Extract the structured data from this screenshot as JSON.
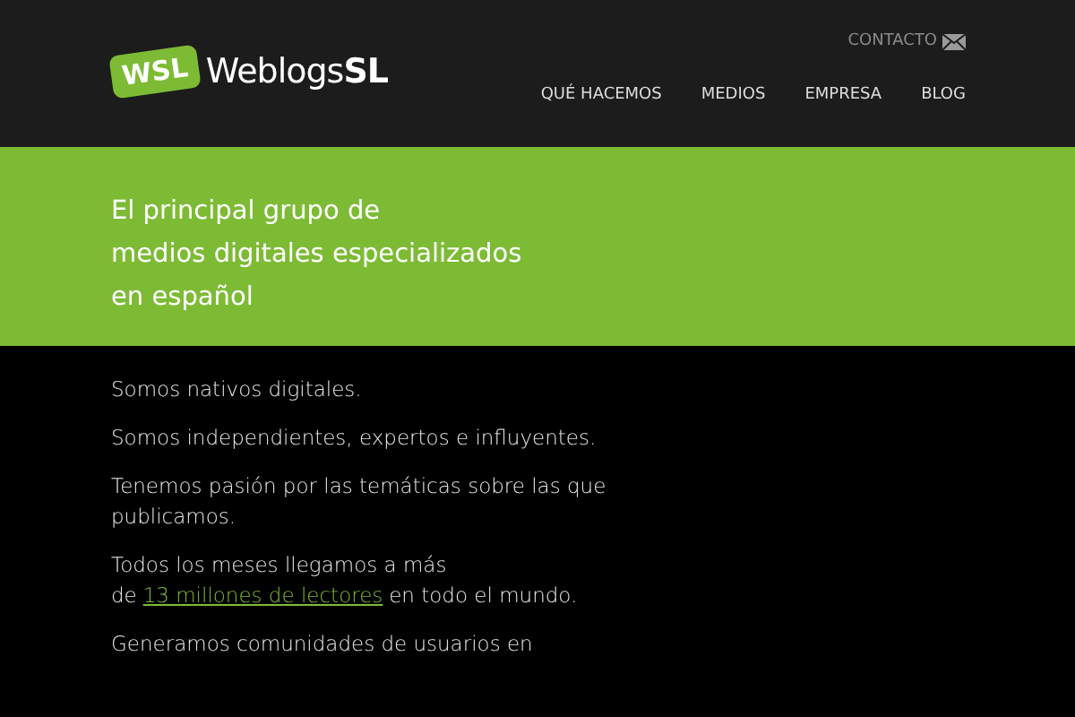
{
  "header": {
    "logo_badge": "WSL",
    "logo_name": "Weblogs**SL**",
    "contact": "CONTACTO",
    "nav": [
      {
        "label": "QUÉ HACEMOS"
      },
      {
        "label": "MEDIOS"
      },
      {
        "label": "EMPRESA"
      },
      {
        "label": "BLOG"
      }
    ]
  },
  "hero": {
    "lines": [
      "El principal grupo de",
      "medios digitales especializados",
      "en español"
    ]
  },
  "paragraphs": [
    {
      "text": "Somos nativos digitales."
    },
    {
      "text": "Somos independientes, expertos e influyentes."
    },
    {
      "text": "Tenemos pasión por las temáticas sobre las que publicamos."
    },
    {
      "text": "Todos los meses llegamos a más de",
      "link": "13 millones de lectores",
      "after": "en todo el mundo."
    },
    {
      "text": "Generamos comunidades de usuarios en"
    }
  ]
}
